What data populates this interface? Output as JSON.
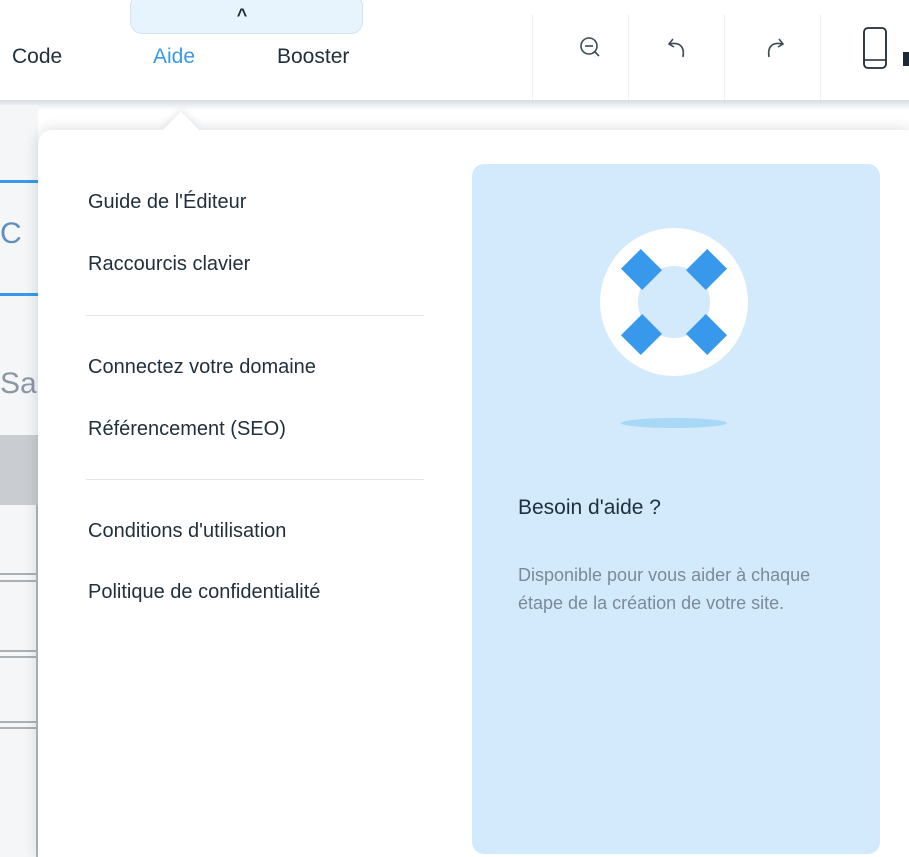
{
  "topbar": {
    "menu": [
      {
        "label": "Code"
      },
      {
        "label": "Aide"
      },
      {
        "label": "Booster"
      }
    ],
    "tools": {
      "zoom_out_icon": "zoom-out-icon",
      "undo_icon": "undo-icon",
      "redo_icon": "redo-icon",
      "mobile_icon": "mobile-icon"
    }
  },
  "background_editor": {
    "partial_text_1": "C",
    "partial_text_2": "Sa"
  },
  "help_menu": {
    "groups": [
      [
        "Guide de l'Éditeur",
        "Raccourcis clavier"
      ],
      [
        "Connectez votre domaine",
        "Référencement (SEO)"
      ],
      [
        "Conditions d'utilisation",
        "Politique de confidentialité"
      ]
    ]
  },
  "help_card": {
    "icon": "lifebuoy-icon",
    "title": "Besoin d'aide ?",
    "description": "Disponible pour vous aider à chaque étape de la création de votre site."
  },
  "colors": {
    "accent": "#3899ec",
    "card_bg": "#d3eafd",
    "text": "#20303c",
    "muted": "#7a8a99"
  }
}
